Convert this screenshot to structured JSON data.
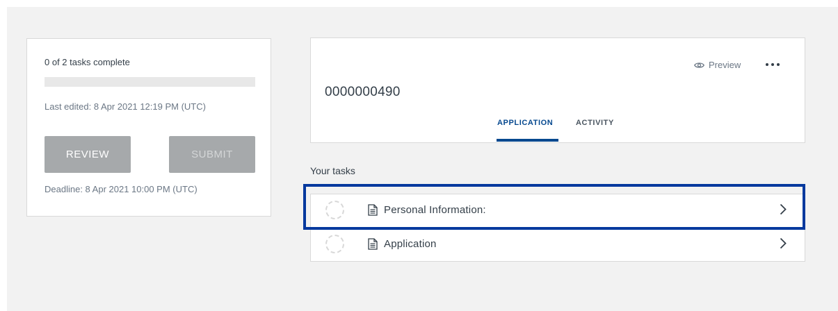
{
  "status_card": {
    "tasks_complete": "0 of 2 tasks complete",
    "progress_fraction": 0,
    "last_edited": "Last edited: 8 Apr 2021 12:19 PM (UTC)",
    "review_label": "REVIEW",
    "submit_label": "SUBMIT",
    "deadline": "Deadline: 8 Apr 2021 10:00 PM (UTC)"
  },
  "header": {
    "preview_label": "Preview",
    "more_icon": "more-horizontal-icon",
    "application_id": "0000000490",
    "tabs": [
      {
        "label": "APPLICATION",
        "active": true
      },
      {
        "label": "ACTIVITY",
        "active": false
      }
    ]
  },
  "tasks": {
    "heading": "Your tasks",
    "items": [
      {
        "label": "Personal Information:",
        "status": "not-started",
        "highlighted": true
      },
      {
        "label": "Application",
        "status": "not-started",
        "highlighted": false
      }
    ]
  },
  "colors": {
    "accent": "#05488f",
    "highlight": "#05399e",
    "button_disabled": "#a6a9ab",
    "background": "#f2f2f2"
  }
}
